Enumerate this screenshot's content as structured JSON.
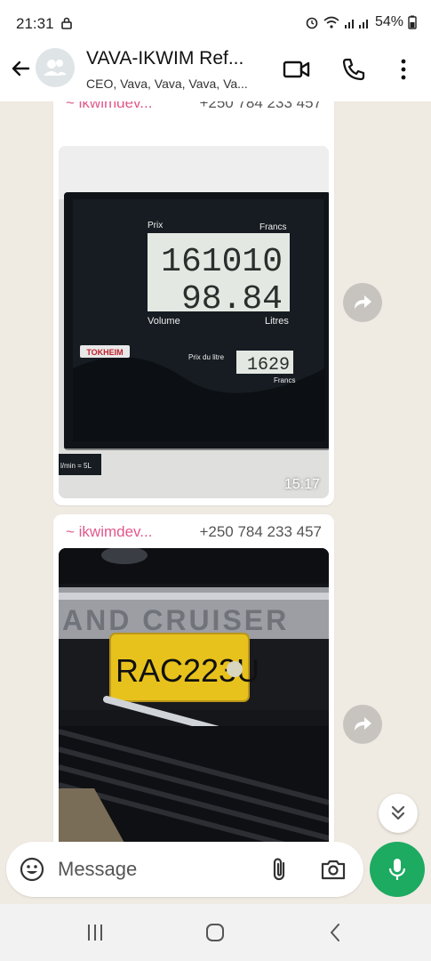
{
  "status_bar": {
    "time": "21:31",
    "battery": "54%",
    "icons": [
      "lock-icon",
      "alarm-icon",
      "wifi-icon",
      "signal-icon",
      "battery-icon"
    ]
  },
  "header": {
    "title": "VAVA-IKWIM Ref...",
    "members": "CEO, Vava, Vava, Vava, Va..."
  },
  "messages": [
    {
      "sender": "~ ikwimdev...",
      "phone": "+250 784 233 457",
      "time": "15:17",
      "pump": {
        "prix_label": "Prix",
        "francs_label": "Francs",
        "prix_value": "161010",
        "volume_value": "98.84",
        "volume_label": "Volume",
        "litres_label": "Litres",
        "brand": "TOKHEIM",
        "prix_litre_label": "Prix du litre",
        "prix_litre_value": "1629",
        "francs_small": "Francs",
        "sticker": "l/min = 5L"
      }
    },
    {
      "sender": "~ ikwimdev...",
      "phone": "+250 784 233 457",
      "photo": {
        "plate": "RAC223U",
        "badge": "AND CRUISER"
      }
    }
  ],
  "composer": {
    "placeholder": "Message"
  },
  "colors": {
    "sender": "#e2588a",
    "mic_button": "#1daa61",
    "chat_background": "#efeae2"
  }
}
